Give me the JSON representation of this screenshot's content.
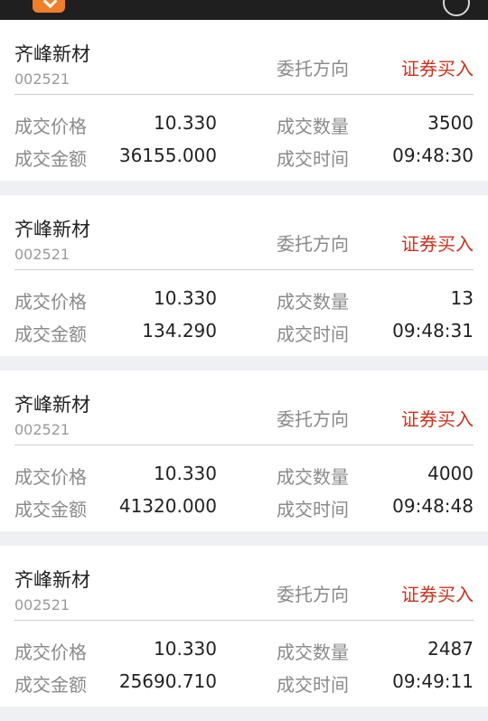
{
  "header": {
    "title": ""
  },
  "labels": {
    "direction": "委托方向",
    "price": "成交价格",
    "quantity": "成交数量",
    "amount": "成交金额",
    "time": "成交时间"
  },
  "records": [
    {
      "name": "齐峰新材",
      "code": "002521",
      "direction": "证券买入",
      "price": "10.330",
      "quantity": "3500",
      "amount": "36155.000",
      "time": "09:48:30"
    },
    {
      "name": "齐峰新材",
      "code": "002521",
      "direction": "证券买入",
      "price": "10.330",
      "quantity": "13",
      "amount": "134.290",
      "time": "09:48:31"
    },
    {
      "name": "齐峰新材",
      "code": "002521",
      "direction": "证券买入",
      "price": "10.330",
      "quantity": "4000",
      "amount": "41320.000",
      "time": "09:48:48"
    },
    {
      "name": "齐峰新材",
      "code": "002521",
      "direction": "证券买入",
      "price": "10.330",
      "quantity": "2487",
      "amount": "25690.710",
      "time": "09:49:11"
    }
  ],
  "colors": {
    "buy": "#c8341e",
    "accent": "#f07f2a",
    "header_bg": "#1f1f1f"
  }
}
